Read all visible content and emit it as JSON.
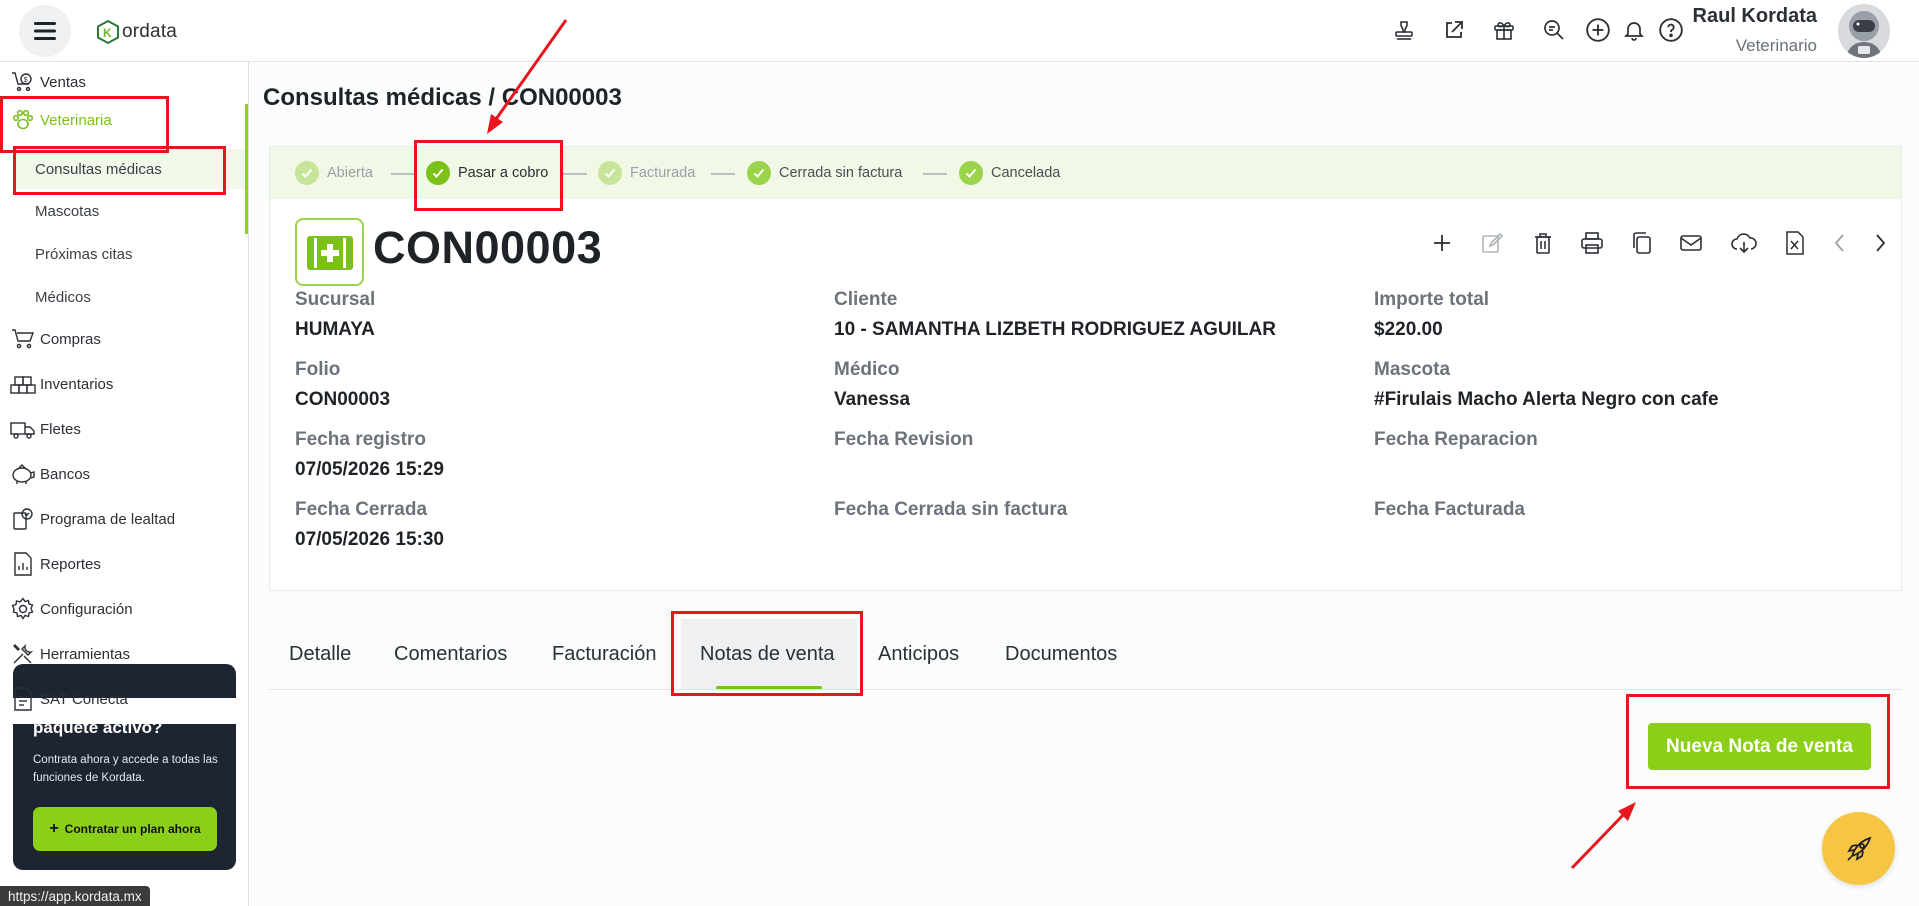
{
  "app": {
    "logo_text": "ordata"
  },
  "header": {
    "user_name": "Raul Kordata",
    "user_role": "Veterinario",
    "icons": [
      "stamp-icon",
      "external-link-icon",
      "gift-icon",
      "search-zoom-icon",
      "plus-circle-icon",
      "bell-icon",
      "help-icon"
    ]
  },
  "sidebar": {
    "items": [
      {
        "label": "Ventas",
        "icon": "cart-money-icon"
      },
      {
        "label": "Veterinaria",
        "icon": "paw-icon"
      },
      {
        "label": "Compras",
        "icon": "cart-icon"
      },
      {
        "label": "Inventarios",
        "icon": "boxes-icon"
      },
      {
        "label": "Fletes",
        "icon": "truck-icon"
      },
      {
        "label": "Bancos",
        "icon": "piggy-bank-icon"
      },
      {
        "label": "Programa de lealtad",
        "icon": "loyalty-icon"
      },
      {
        "label": "Reportes",
        "icon": "report-icon"
      },
      {
        "label": "Configuración",
        "icon": "gear-icon"
      },
      {
        "label": "Herramientas",
        "icon": "tools-icon"
      },
      {
        "label": "SAT Conecta",
        "icon": "document-icon"
      }
    ],
    "sub_items": [
      "Consultas médicas",
      "Mascotas",
      "Próximas citas",
      "Médicos"
    ],
    "promo": {
      "title": "paquete activo?",
      "text": "Contrata ahora y accede a todas las funciones de Kordata.",
      "button": "Contratar un plan ahora"
    }
  },
  "url_tooltip": "https://app.kordata.mx",
  "page": {
    "title": "Consultas médicas / CON00003"
  },
  "status_steps": [
    "Abierta",
    "Pasar a cobro",
    "Facturada",
    "Cerrada sin factura",
    "Cancelada"
  ],
  "record": {
    "number": "CON00003",
    "fields": {
      "sucursal": {
        "label": "Sucursal",
        "value": "HUMAYA"
      },
      "cliente": {
        "label": "Cliente",
        "value": "10 - SAMANTHA LIZBETH RODRIGUEZ AGUILAR"
      },
      "importe": {
        "label": "Importe total",
        "value": "$220.00"
      },
      "folio": {
        "label": "Folio",
        "value": "CON00003"
      },
      "medico": {
        "label": "Médico",
        "value": "Vanessa"
      },
      "mascota": {
        "label": "Mascota",
        "value": "#Firulais Macho Alerta Negro con cafe"
      },
      "fecha_registro": {
        "label": "Fecha registro",
        "value": "07/05/2026 15:29"
      },
      "fecha_revision": {
        "label": "Fecha Revision",
        "value": ""
      },
      "fecha_reparacion": {
        "label": "Fecha Reparacion",
        "value": ""
      },
      "fecha_cerrada": {
        "label": "Fecha Cerrada",
        "value": "07/05/2026 15:30"
      },
      "fecha_cerrada_sin_factura": {
        "label": "Fecha Cerrada sin factura",
        "value": ""
      },
      "fecha_facturada": {
        "label": "Fecha Facturada",
        "value": ""
      }
    }
  },
  "tabs": [
    "Detalle",
    "Comentarios",
    "Facturación",
    "Notas de venta",
    "Anticipos",
    "Documentos"
  ],
  "actions": {
    "new_sale_note": "Nueva Nota de venta"
  },
  "colors": {
    "accent": "#8ccf18",
    "annotation": "#e8141e",
    "fab": "#f6c544",
    "promo_bg": "#1e2532"
  }
}
